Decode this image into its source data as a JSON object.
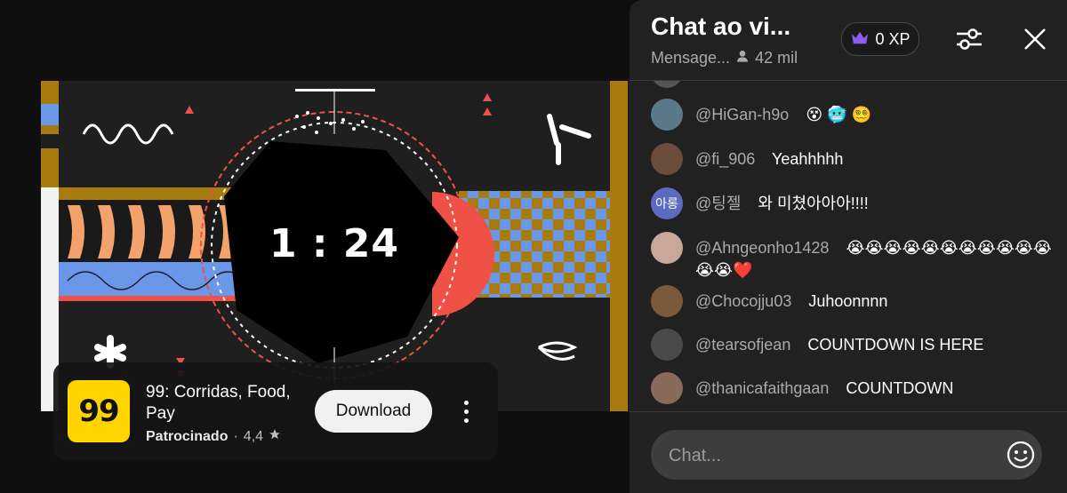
{
  "video": {
    "countdown": "1 : 24"
  },
  "ad": {
    "logo_text": "99",
    "title": "99: Corridas, Food, Pay",
    "sponsored": "Patrocinado",
    "separator": "·",
    "rating": "4,4",
    "rating_icon": "star-icon",
    "download_label": "Download"
  },
  "chat": {
    "title": "Chat ao vi...",
    "subtitle": "Mensage...",
    "viewers": "42 mil",
    "xp": "0 XP",
    "input_placeholder": "Chat...",
    "messages": [
      {
        "author": "@HiGan-h9o",
        "text": "",
        "emojis": [
          "😵",
          "🥶",
          "😵‍💫"
        ],
        "avatar_color": "#5a7a8a",
        "avatar_text": ""
      },
      {
        "author": "@fi_906",
        "text": "Yeahhhhh",
        "emojis": [],
        "avatar_color": "#6b4d3d",
        "avatar_text": ""
      },
      {
        "author": "@팅젤",
        "text": "와 미쳤아아아!!!!",
        "emojis": [],
        "avatar_color": "#5c6bc0",
        "avatar_text": "아롱"
      },
      {
        "author": "@Ahngeonho1428",
        "text": "",
        "emojis": [
          "😭",
          "😭",
          "😭",
          "😭",
          "😭",
          "😭",
          "😭",
          "😭",
          "😭",
          "😭",
          "😭",
          "😭",
          "😭",
          "❤️"
        ],
        "avatar_color": "#c9a89a",
        "avatar_text": ""
      },
      {
        "author": "@Chocojju03",
        "text": "Juhoonnnn",
        "emojis": [],
        "avatar_color": "#7a5a3a",
        "avatar_text": ""
      },
      {
        "author": "@tearsofjean",
        "text": "COUNTDOWN IS HERE",
        "emojis": [],
        "avatar_color": "#4a4a4a",
        "avatar_text": ""
      },
      {
        "author": "@thanicafaithgaan",
        "text": "COUNTDOWN",
        "emojis": [],
        "avatar_color": "#8a6a5a",
        "avatar_text": ""
      }
    ]
  },
  "colors": {
    "brand_yellow": "#ffd400",
    "accent_red": "#ef5147",
    "stripe_orange": "#f4a26b",
    "stripe_blue": "#6b97e8",
    "ochre": "#a77b0f",
    "crown_purple": "#8d5cf6"
  }
}
